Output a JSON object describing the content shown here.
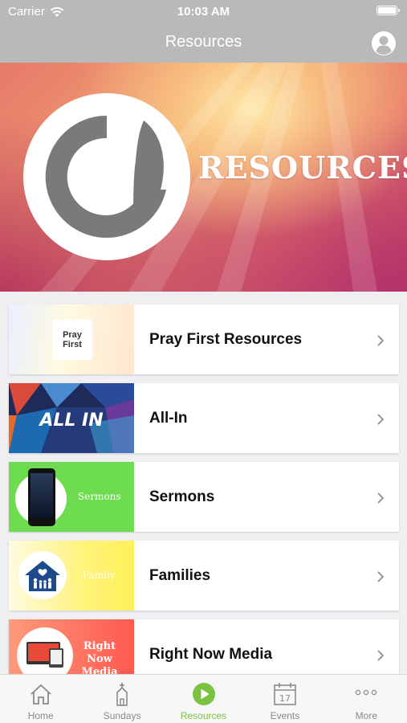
{
  "status_bar": {
    "carrier": "Carrier",
    "time": "10:03 AM"
  },
  "nav": {
    "title": "Resources"
  },
  "banner": {
    "title": "RESOURCES"
  },
  "resources": [
    {
      "label": "Pray First Resources",
      "thumb_text": [
        "Pray",
        "First"
      ]
    },
    {
      "label": "All-In",
      "thumb_text": "ALL IN"
    },
    {
      "label": "Sermons",
      "thumb_text": "Sermons"
    },
    {
      "label": "Families",
      "thumb_text": "Family"
    },
    {
      "label": "Right Now Media",
      "thumb_text": [
        "Right Now",
        "Media"
      ]
    }
  ],
  "tabs": [
    {
      "label": "Home",
      "icon": "home-icon"
    },
    {
      "label": "Sundays",
      "icon": "church-icon"
    },
    {
      "label": "Resources",
      "icon": "play-icon",
      "active": true
    },
    {
      "label": "Events",
      "icon": "calendar-icon",
      "calendar_day": "17"
    },
    {
      "label": "More",
      "icon": "more-icon"
    }
  ],
  "colors": {
    "accent": "#7cc242",
    "bar": "#b9b9b9"
  }
}
